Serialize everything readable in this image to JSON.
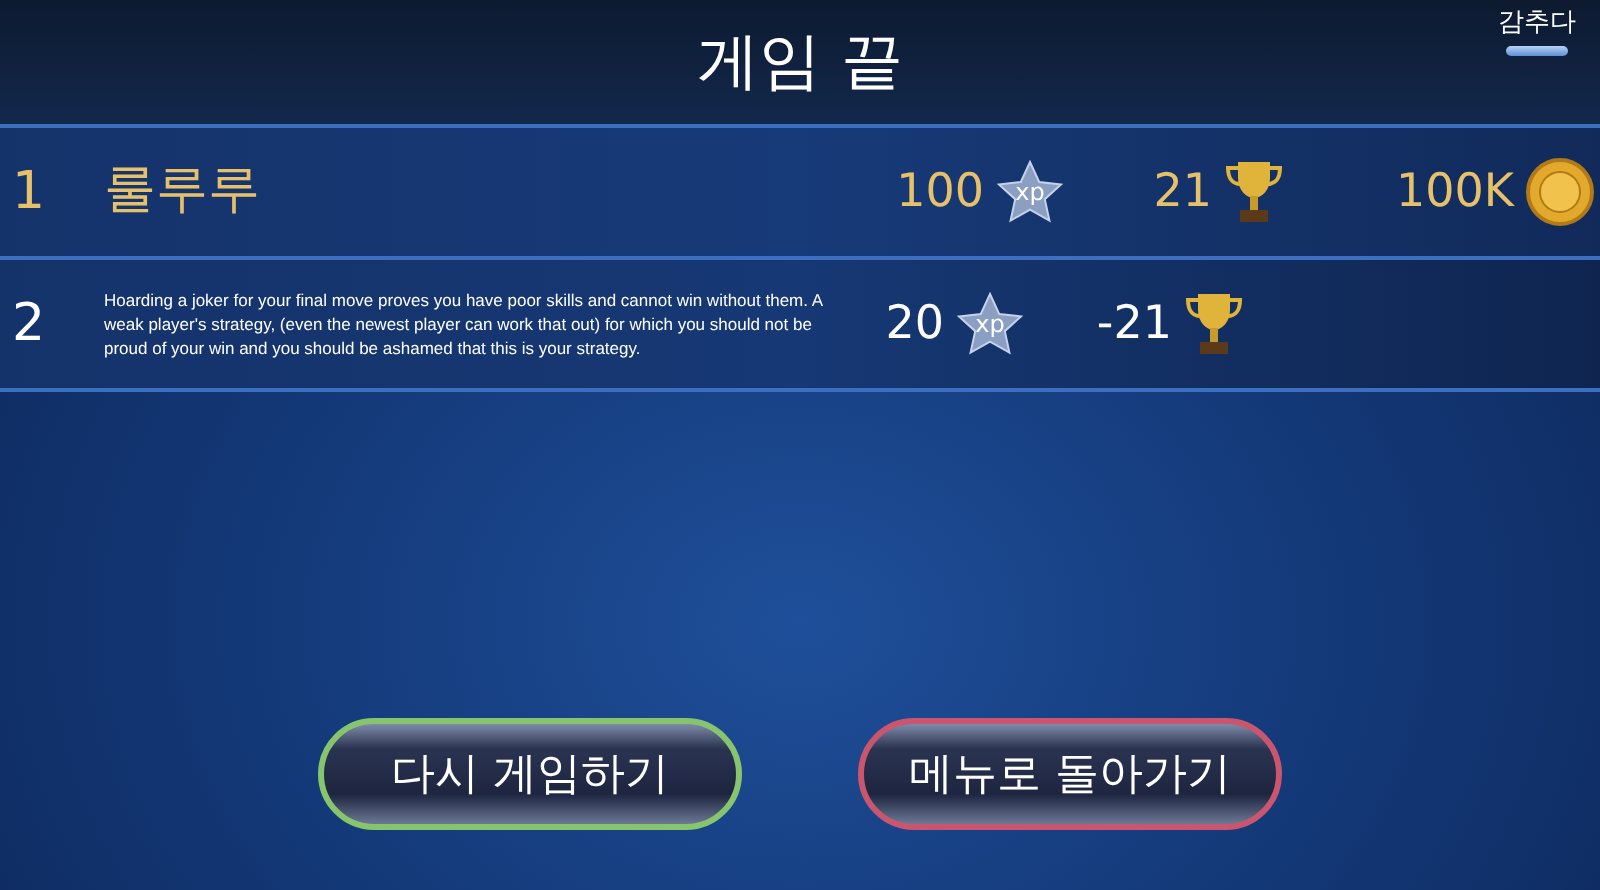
{
  "title": "게임 끝",
  "hide_button": {
    "label": "감추다"
  },
  "players": [
    {
      "rank": "1",
      "name": "룰루루",
      "winner": true,
      "xp": "100",
      "xp_badge": "xp",
      "trophies": "21",
      "coins": "100K"
    },
    {
      "rank": "2",
      "name": "Hoarding a joker for your final move proves you have poor skills and cannot win without them. A weak player's strategy, (even the newest player can work that out) for which you should not be proud of your win and you should be ashamed that this is your strategy.",
      "winner": false,
      "xp": "20",
      "xp_badge": "xp",
      "trophies": "-21"
    }
  ],
  "buttons": [
    {
      "label": "다시 게임하기",
      "color": "#86c46e"
    },
    {
      "label": "메뉴로 돌아가기",
      "color": "#c9566e"
    }
  ]
}
